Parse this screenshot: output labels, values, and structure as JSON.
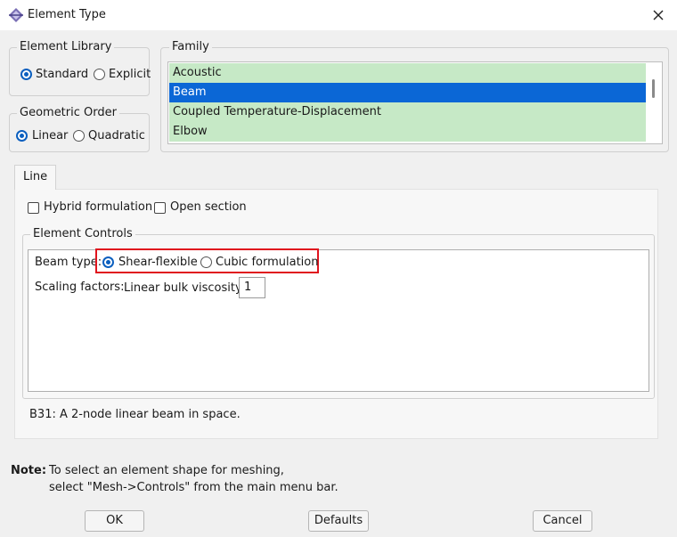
{
  "window": {
    "title": "Element Type",
    "title_icon": "abaqus-element-icon",
    "close_icon": "close-icon"
  },
  "element_library": {
    "label": "Element Library",
    "options": [
      "Standard",
      "Explicit"
    ],
    "selected": "Standard"
  },
  "geometric_order": {
    "label": "Geometric Order",
    "options": [
      "Linear",
      "Quadratic"
    ],
    "selected": "Linear"
  },
  "family": {
    "label": "Family",
    "items": [
      "Acoustic",
      "Beam",
      "Coupled Temperature-Displacement",
      "Elbow"
    ],
    "selected": "Beam"
  },
  "tab": {
    "label": "Line"
  },
  "options": {
    "hybrid_label": "Hybrid formulation",
    "hybrid_checked": false,
    "open_section_label": "Open section",
    "open_section_checked": false
  },
  "element_controls": {
    "label": "Element Controls",
    "beam_type_label": "Beam type:",
    "beam_types": [
      "Shear-flexible",
      "Cubic formulation"
    ],
    "beam_type_selected": "Shear-flexible",
    "scaling_label": "Scaling factors:",
    "viscosity_label": "Linear bulk viscosity:",
    "viscosity_value": "1"
  },
  "description": "B31:  A 2-node linear beam in space.",
  "note": {
    "label": "Note:",
    "line1": "To select an element shape for meshing,",
    "line2": "select \"Mesh->Controls\" from the main menu bar."
  },
  "buttons": {
    "ok": "OK",
    "defaults": "Defaults",
    "cancel": "Cancel"
  },
  "colors": {
    "accent": "#0b67d6",
    "list_bg": "#c6e9c6",
    "highlight": "#e0141e"
  }
}
